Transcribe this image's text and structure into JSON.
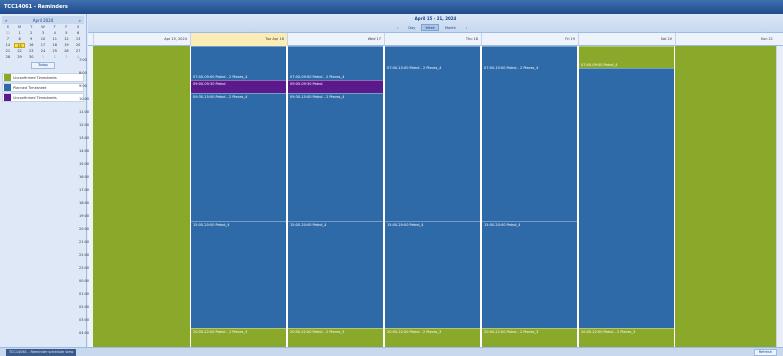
{
  "window": {
    "title": "TCC14061 - Reminders"
  },
  "mini_calendar": {
    "month_label": "April 2024",
    "prev_label": "«",
    "next_label": "»",
    "dow": [
      "S",
      "M",
      "T",
      "W",
      "T",
      "F",
      "S"
    ],
    "weeks": [
      [
        "31",
        "1",
        "2",
        "3",
        "4",
        "5",
        "6"
      ],
      [
        "7",
        "8",
        "9",
        "10",
        "11",
        "12",
        "13"
      ],
      [
        "14",
        "15",
        "16",
        "17",
        "18",
        "19",
        "20"
      ],
      [
        "21",
        "22",
        "23",
        "24",
        "25",
        "26",
        "27"
      ],
      [
        "28",
        "29",
        "30",
        "1",
        "2",
        "3",
        "4"
      ]
    ],
    "today_label": "Today"
  },
  "legend": [
    {
      "label": "Unconfirmed Timesheets",
      "color": "#8aa82a"
    },
    {
      "label": "Planned Timesheet",
      "color": "#2f6aa8"
    },
    {
      "label": "Unconfirmed Timesheets",
      "color": "#5a1a8c"
    }
  ],
  "toolbar": {
    "range_title": "April 15 - 21, 2024",
    "prev": "‹",
    "day": "Day",
    "week": "Week",
    "month": "Month",
    "next": "›"
  },
  "days": [
    "Apr 15, 2024",
    "Tue Apr 16",
    "Wed 17",
    "Thu 18",
    "Fri 19",
    "Sat 20",
    "Sun 21"
  ],
  "times": [
    "7:00",
    "8:00",
    "9:00",
    "10:00",
    "11:00",
    "12:00",
    "13:00",
    "14:00",
    "15:00",
    "16:00",
    "17:00",
    "18:00",
    "19:00",
    "20:00",
    "21:00",
    "22:00",
    "23:00",
    "00:00",
    "01:00",
    "02:00",
    "03:00",
    "04:00"
  ],
  "events": {
    "tue_1": "07:00-09:00 Patrol - 2 Pieces_4",
    "tue_2": "09:00-09:30 Patrol",
    "tue_3": "09:30-15:00 Patrol - 2 Pieces_4",
    "tue_4": "15:00-20:00 Patrol_4",
    "tue_5": "20:00-22:00 Patrol - 2 Pieces_3",
    "wed_1": "07:00-09:00 Patrol - 2 Pieces_4",
    "wed_2": "09:00-09:30 Patrol",
    "wed_3": "09:30-15:00 Patrol - 2 Pieces_4",
    "wed_4": "15:00-20:00 Patrol_4",
    "wed_5": "20:00-22:00 Patrol - 2 Pieces_3",
    "thu_1": "07:00-15:00 Patrol - 2 Pieces_4",
    "thu_2": "15:00-20:00 Patrol_4",
    "thu_3": "20:00-22:00 Patrol - 2 Pieces_3",
    "fri_1": "07:00-15:00 Patrol - 2 Pieces_4",
    "fri_2": "15:00-20:00 Patrol_4",
    "fri_3": "20:00-22:00 Patrol - 2 Pieces_3",
    "sat_1": "07:00-09:00 Patrol_4",
    "sat_2": "20:00-22:00 Patrol - 2 Pieces_3"
  },
  "colors": {
    "unconfirmed": "#8aa82a",
    "planned": "#2f6aa8",
    "purple": "#5a1a8c"
  },
  "status": {
    "text": "TCC14061 - Reminder schedule view",
    "button": "Refresh"
  }
}
